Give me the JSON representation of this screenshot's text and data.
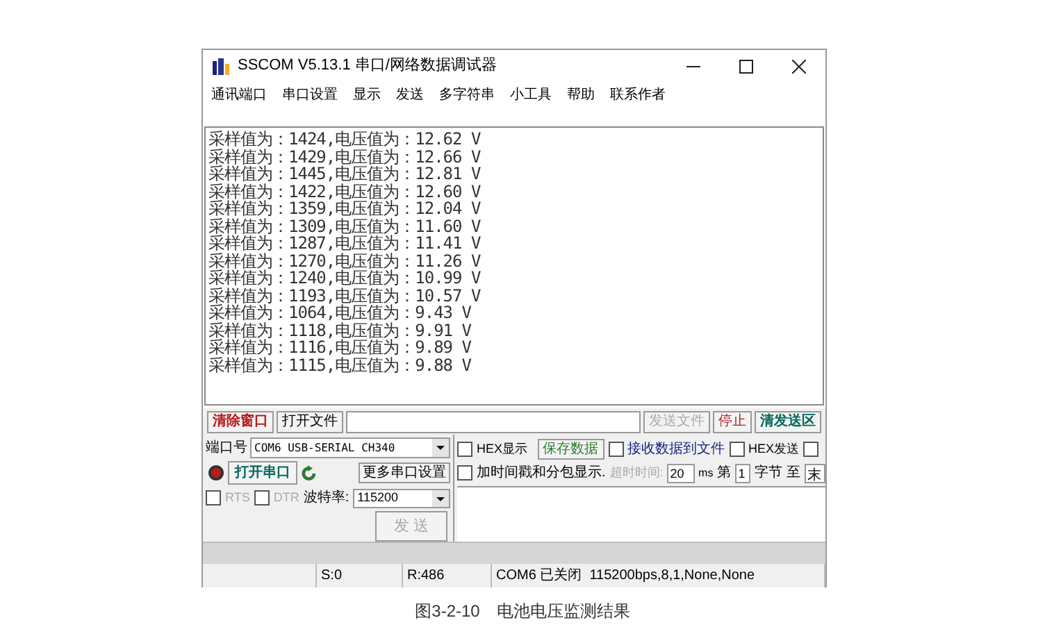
{
  "window": {
    "title": "SSCOM V5.13.1 串口/网络数据调试器"
  },
  "menu": [
    "通讯端口",
    "串口设置",
    "显示",
    "发送",
    "多字符串",
    "小工具",
    "帮助",
    "联系作者"
  ],
  "receive_lines": [
    "采样值为：1424,电压值为：12.62 V",
    "采样值为：1429,电压值为：12.66 V",
    "采样值为：1445,电压值为：12.81 V",
    "采样值为：1422,电压值为：12.60 V",
    "采样值为：1359,电压值为：12.04 V",
    "采样值为：1309,电压值为：11.60 V",
    "采样值为：1287,电压值为：11.41 V",
    "采样值为：1270,电压值为：11.26 V",
    "采样值为：1240,电压值为：10.99 V",
    "采样值为：1193,电压值为：10.57 V",
    "采样值为：1064,电压值为：9.43 V",
    "采样值为：1118,电压值为：9.91 V",
    "采样值为：1116,电压值为：9.89 V",
    "采样值为：1115,电压值为：9.88 V"
  ],
  "toolbar": {
    "clear_button": "清除窗口",
    "open_file_button": "打开文件",
    "send_file_button": "发送文件",
    "stop_button": "停止",
    "clear_send_button": "清发送区"
  },
  "port_panel": {
    "port_label": "端口号",
    "port_value": "COM6 USB-SERIAL CH340",
    "port_open": false,
    "open_button": "打开串口",
    "more_settings_button": "更多串口设置",
    "rts": {
      "label": "RTS",
      "checked": false
    },
    "dtr": {
      "label": "DTR",
      "checked": false
    },
    "baud_label": "波特率:",
    "baud_value": "115200",
    "send_button": "发 送"
  },
  "options": {
    "hex_display": {
      "label": "HEX显示",
      "checked": false
    },
    "save_button": "保存数据",
    "receive_to_file": {
      "label": "接收数据到文件",
      "checked": false
    },
    "hex_send": {
      "label": "HEX发送",
      "checked": false
    },
    "cut_option": {
      "checked": false
    },
    "timestamp": {
      "label": "加时间戳和分包显示.",
      "checked": false
    },
    "timeout_label": "超时时间:",
    "timeout_value": "20",
    "timeout_unit": "ms",
    "byte_prefix": "第",
    "byte_from": "1",
    "byte_label": "字节",
    "byte_to_label": "至",
    "byte_to": "末"
  },
  "status_bar": [
    "S:0",
    "R:486",
    "COM6 已关闭  115200bps,8,1,None,None"
  ],
  "caption": "图3-2-10　电池电压监测结果"
}
